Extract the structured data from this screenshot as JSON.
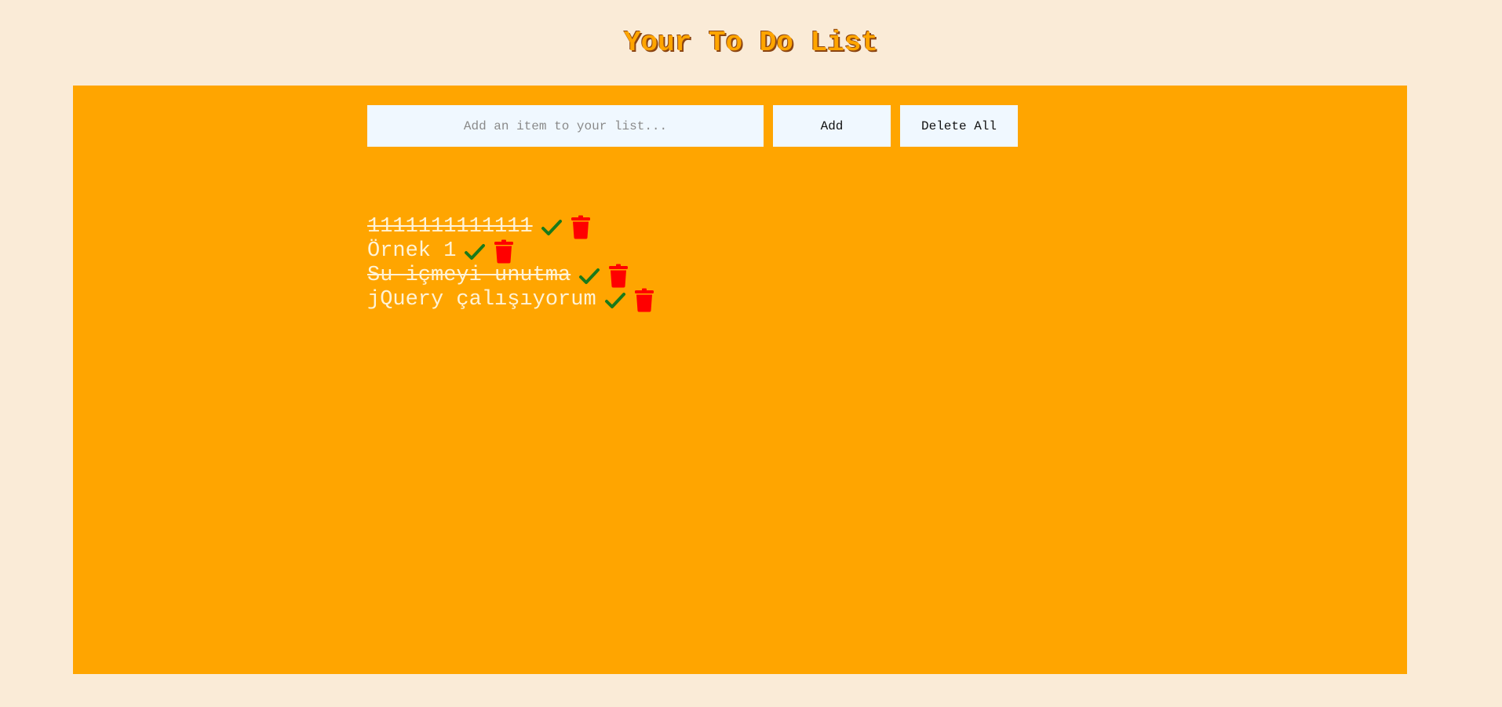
{
  "header": {
    "title": "Your To Do List"
  },
  "controls": {
    "input_placeholder": "Add an item to your list...",
    "input_value": "",
    "add_label": "Add",
    "delete_all_label": "Delete All"
  },
  "todo_items": [
    {
      "text": "1111111111111",
      "done": true
    },
    {
      "text": "Örnek 1",
      "done": false
    },
    {
      "text": "Su içmeyi unutma",
      "done": true
    },
    {
      "text": "jQuery çalışıyorum",
      "done": false
    }
  ],
  "icons": {
    "check": "check-icon",
    "delete": "trash-icon"
  },
  "colors": {
    "page_background": "#faebd7",
    "panel_background": "#ffa500",
    "title_text": "#ffa500",
    "title_shadow": "#8b4513",
    "control_background": "#f0f8ff",
    "item_text": "#fff3d6",
    "check_icon": "#1a7a1a",
    "trash_icon": "#ff0000"
  }
}
